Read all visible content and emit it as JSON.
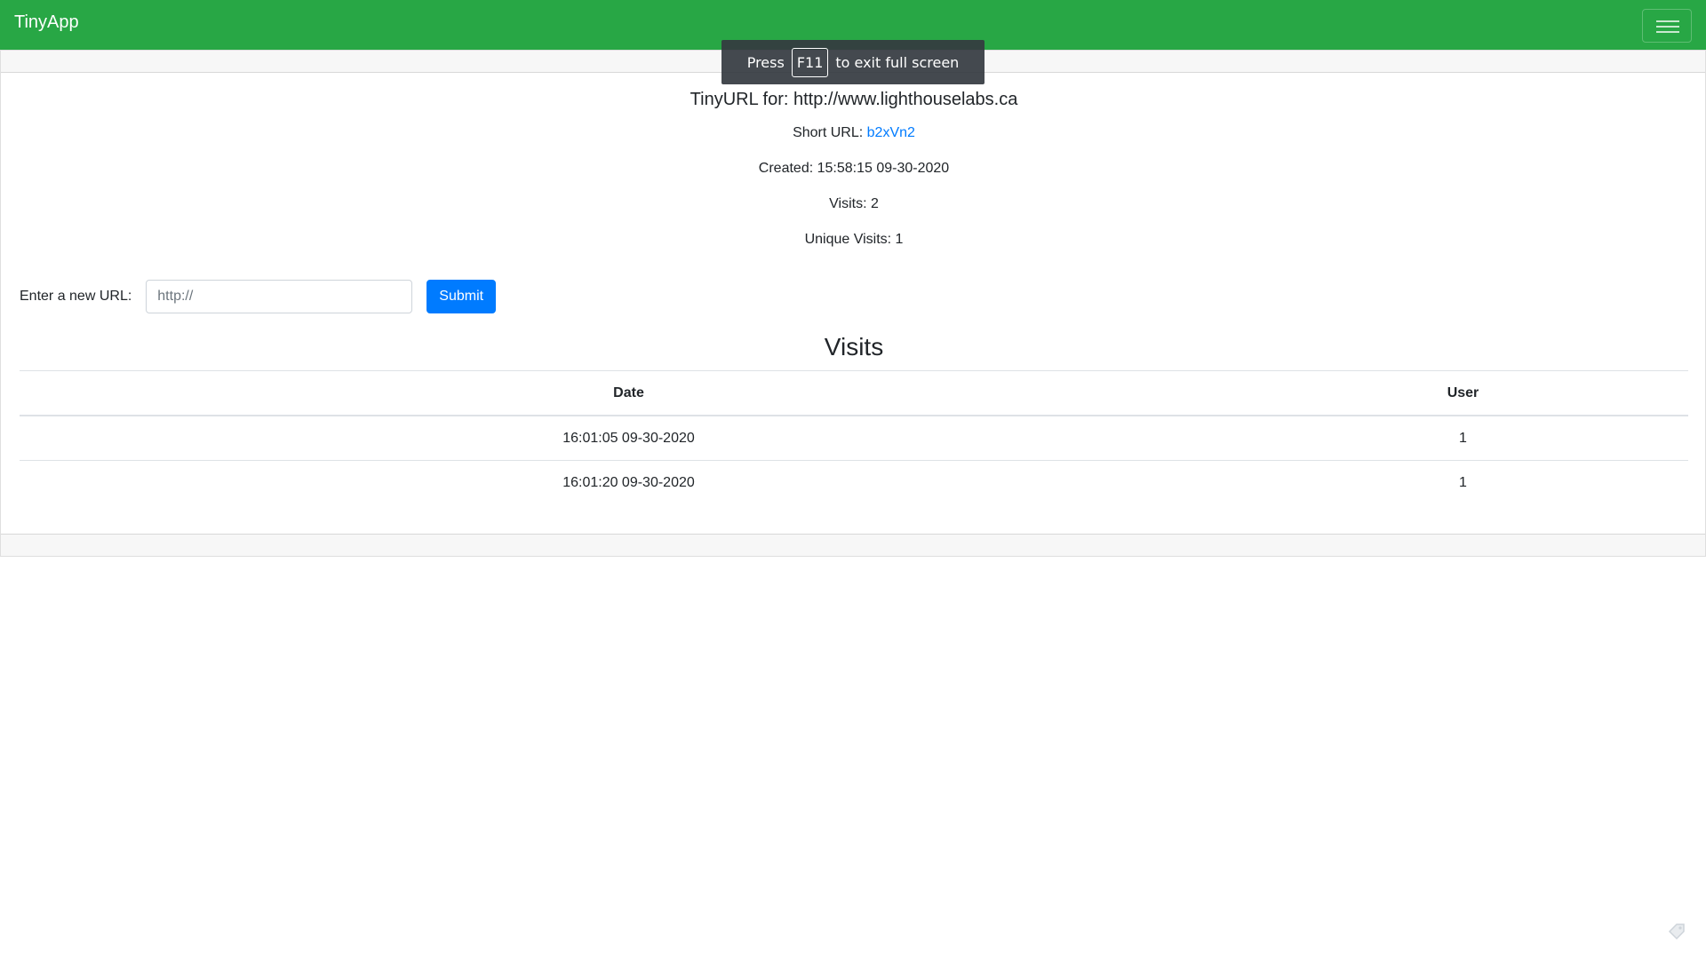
{
  "navbar": {
    "brand": "TinyApp",
    "menu_icon": "hamburger-icon",
    "color": "#28a745"
  },
  "fullscreen_notice": {
    "before": "Press",
    "key": "F11",
    "after": "to exit full screen"
  },
  "url_info": {
    "title": "TinyURL for: http://www.lighthouselabs.ca",
    "short_url_label": "Short URL:",
    "short_url_value": "b2xVn2",
    "created": "Created: 15:58:15 09-30-2020",
    "visits": "Visits: 2",
    "unique_visits": "Unique Visits: 1"
  },
  "form": {
    "label": "Enter a new URL:",
    "placeholder": "http://",
    "value": "",
    "submit_label": "Submit",
    "submit_color": "#007bff"
  },
  "visits_section": {
    "heading": "Visits",
    "columns": [
      "Date",
      "User"
    ],
    "rows": [
      {
        "date": "16:01:05 09-30-2020",
        "user": "1"
      },
      {
        "date": "16:01:20 09-30-2020",
        "user": "1"
      }
    ]
  },
  "corner_icon": "tag-icon"
}
